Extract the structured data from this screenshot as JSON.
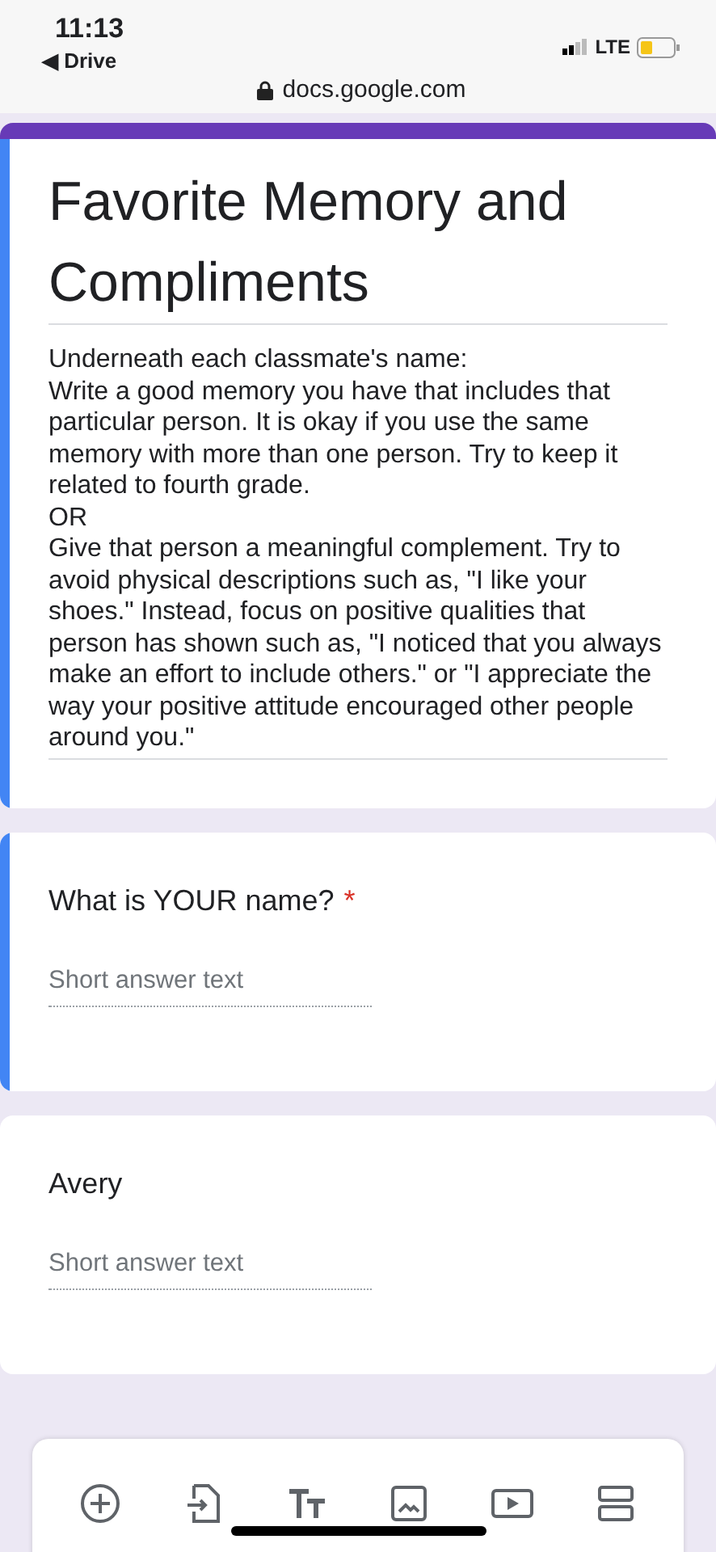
{
  "status_bar": {
    "time": "11:13",
    "back_label": "◀ Drive",
    "network": "LTE"
  },
  "browser": {
    "url": "docs.google.com"
  },
  "form": {
    "title": "Favorite Memory and Compliments",
    "description": [
      "Underneath each classmate's name:",
      "Write a good memory you have that includes that particular person. It is okay if you use the same memory with more than one person. Try to keep it related to fourth grade.",
      "OR",
      "Give that person a meaningful complement. Try to avoid physical descriptions such as, \"I like your shoes.\" Instead, focus on positive qualities that person has shown such as, \"I noticed that you always make an effort to include others.\" or \"I appreciate the way your positive attitude encouraged other people around you.\""
    ]
  },
  "questions": [
    {
      "title": "What is YOUR name?",
      "required": true,
      "required_mark": "*",
      "placeholder": "Short answer text",
      "selected": true
    },
    {
      "title": "Avery",
      "required": false,
      "placeholder": "Short answer text",
      "selected": false
    }
  ]
}
